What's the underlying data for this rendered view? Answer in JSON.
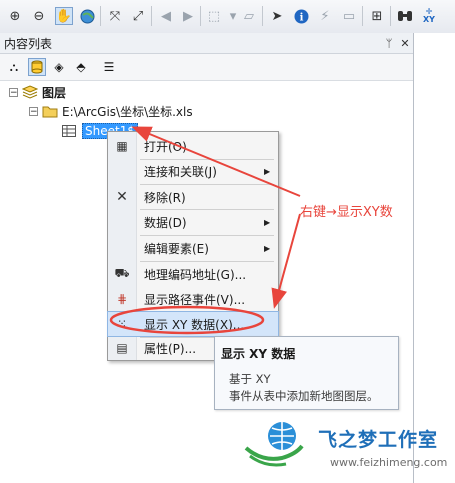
{
  "toolbar": {
    "xy_label": "XY"
  },
  "toc": {
    "title": "内容列表",
    "pin": "ᛘ",
    "close": "✕"
  },
  "tree": {
    "root_label": "图层",
    "workspace_label": "E:\\ArcGis\\坐标\\坐标.xls",
    "sheet_label": "Sheet1$"
  },
  "context_menu": {
    "items": [
      {
        "label": "打开(O)",
        "icon": "table-icon"
      },
      {
        "label": "连接和关联(J)",
        "icon": "",
        "submenu": "▶"
      },
      {
        "label": "移除(R)",
        "icon": "remove-icon"
      },
      {
        "label": "数据(D)",
        "icon": "",
        "submenu": "▶"
      },
      {
        "label": "编辑要素(E)",
        "icon": "",
        "submenu": "▶"
      },
      {
        "label": "地理编码地址(G)...",
        "icon": "geocode-icon"
      },
      {
        "label": "显示路径事件(V)...",
        "icon": "route-event-icon"
      },
      {
        "label": "显示 XY 数据(X)...",
        "icon": "xy-data-icon"
      },
      {
        "label": "属性(P)...",
        "icon": "properties-icon"
      }
    ]
  },
  "tooltip": {
    "title": "显示 XY 数据",
    "line1": "基于 XY",
    "line2": "事件从表中添加新地图图层。"
  },
  "annotation": {
    "text": "右键→显示XY数",
    "color": "#e8453c"
  },
  "watermark": {
    "name": "飞之梦工作室",
    "url": "www.feizhimeng.com"
  }
}
